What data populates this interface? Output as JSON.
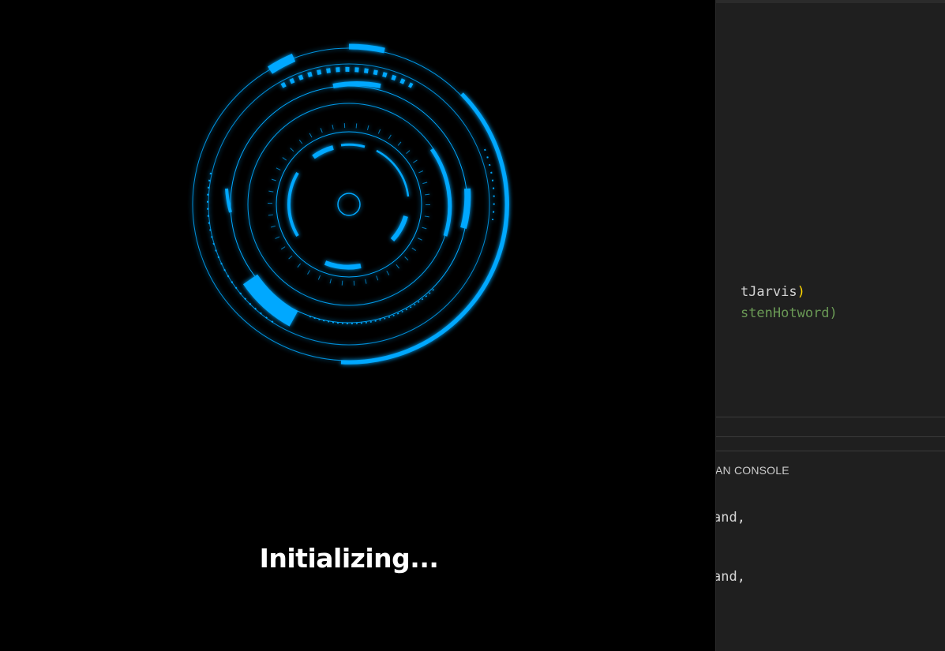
{
  "editor": {
    "code_lines": [
      {
        "text": "tJarvis",
        "closing": ")"
      },
      {
        "text": "stenHotword)"
      }
    ],
    "panel_tab": "AN CONSOLE",
    "terminal_lines": [
      "and,",
      "and,"
    ]
  },
  "loader": {
    "status": "Initializing...",
    "accent_color": "#00a8ff",
    "glow_color": "#0090ff"
  }
}
